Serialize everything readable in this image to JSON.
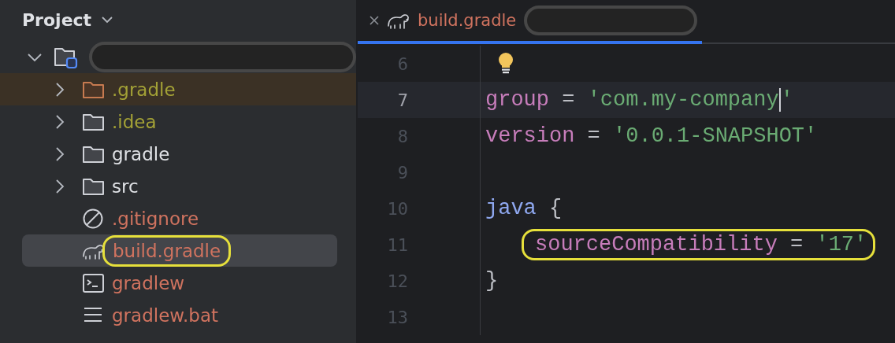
{
  "project_panel": {
    "title": "Project",
    "tree": [
      {
        "kind": "root",
        "expanded": true,
        "redacted": true,
        "selected": false,
        "children": [
          {
            "label": ".gradle",
            "kind": "excluded-folder",
            "color": "#a3a136",
            "expanded": false,
            "flagged": true,
            "selected": false
          },
          {
            "label": ".idea",
            "kind": "folder",
            "color": "#a3a136",
            "expanded": false,
            "selected": false
          },
          {
            "label": "gradle",
            "kind": "folder",
            "color": "#dfe1e5",
            "expanded": false,
            "selected": false
          },
          {
            "label": "src",
            "kind": "folder",
            "color": "#dfe1e5",
            "expanded": false,
            "selected": false
          },
          {
            "label": ".gitignore",
            "kind": "ignore-file",
            "color": "#d0735f",
            "selected": false
          },
          {
            "label": "build.gradle",
            "kind": "gradle-file",
            "color": "#d0735f",
            "selected": true,
            "highlighted": true
          },
          {
            "label": "gradlew",
            "kind": "script-file",
            "color": "#d0735f",
            "selected": false
          },
          {
            "label": "gradlew.bat",
            "kind": "text-file",
            "color": "#d0735f",
            "selected": false
          }
        ]
      }
    ]
  },
  "editor": {
    "tabs": [
      {
        "label": "build.gradle",
        "selected": true,
        "redacted": true
      }
    ],
    "lines": [
      {
        "number": "6",
        "current": false,
        "bulb": true
      },
      {
        "number": "7",
        "current": true,
        "tokens": [
          {
            "kind": "keyword",
            "text": "group"
          },
          {
            "kind": "plain",
            "text": " = "
          },
          {
            "kind": "string",
            "text": "'com.my-company"
          },
          {
            "kind": "caret"
          },
          {
            "kind": "string",
            "text": "'"
          }
        ]
      },
      {
        "number": "8",
        "current": false,
        "tokens": [
          {
            "kind": "keyword",
            "text": "version"
          },
          {
            "kind": "plain",
            "text": " = "
          },
          {
            "kind": "string",
            "text": "'0.0.1-SNAPSHOT'"
          }
        ]
      },
      {
        "number": "9",
        "current": false
      },
      {
        "number": "10",
        "current": false,
        "tokens": [
          {
            "kind": "ident",
            "text": "java"
          },
          {
            "kind": "plain",
            "text": " {"
          }
        ]
      },
      {
        "number": "11",
        "current": false,
        "nested": true,
        "highlighted": true,
        "tokens": [
          {
            "kind": "keyword",
            "text": "sourceCompatibility"
          },
          {
            "kind": "plain",
            "text": " = "
          },
          {
            "kind": "string",
            "text": "'17'"
          }
        ]
      },
      {
        "number": "12",
        "current": false,
        "tokens": [
          {
            "kind": "plain",
            "text": "}"
          }
        ]
      },
      {
        "number": "13",
        "current": false
      }
    ]
  }
}
